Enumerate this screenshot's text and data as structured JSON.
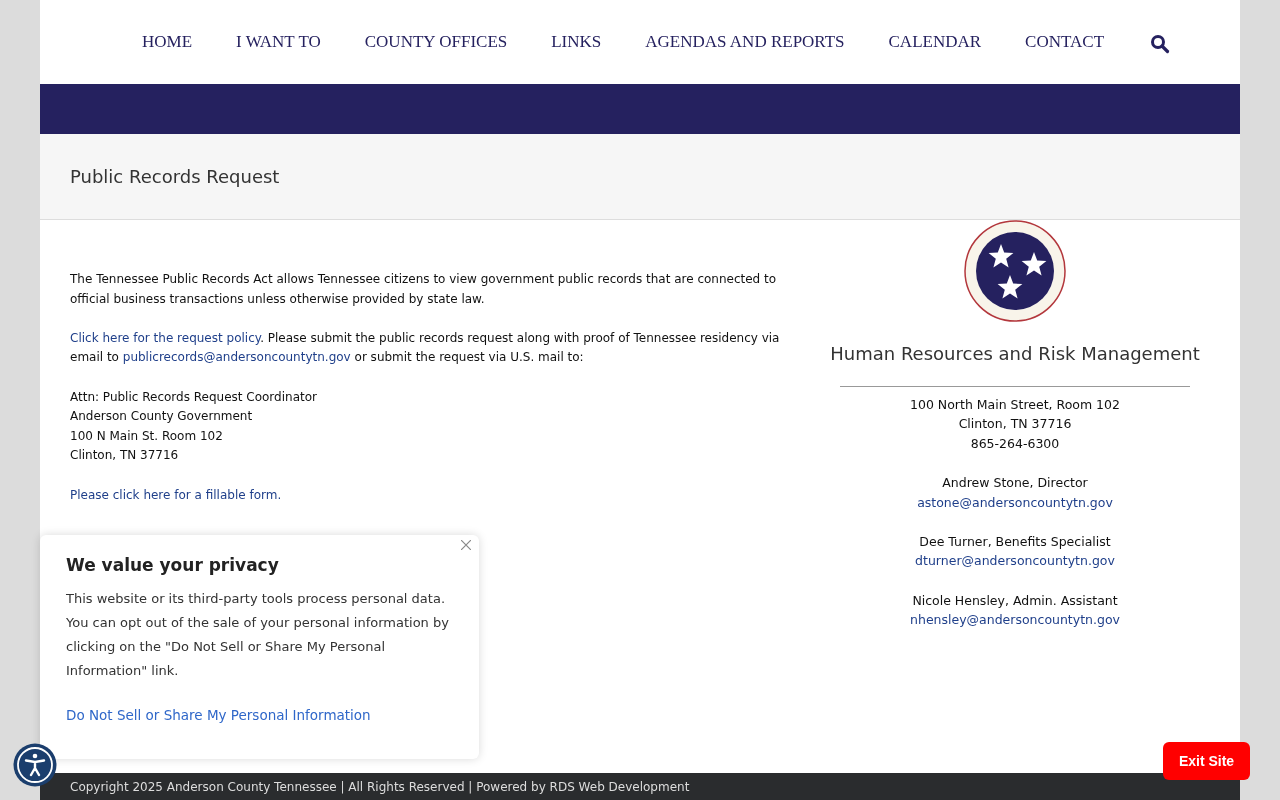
{
  "nav": {
    "items": [
      {
        "label": "HOME"
      },
      {
        "label": "I WANT TO"
      },
      {
        "label": "COUNTY OFFICES"
      },
      {
        "label": "LINKS"
      },
      {
        "label": "AGENDAS AND REPORTS"
      },
      {
        "label": "CALENDAR"
      },
      {
        "label": "CONTACT"
      }
    ]
  },
  "page_title": "Public Records Request",
  "content": {
    "paragraphs": [
      {
        "kind": "text",
        "text": "The Tennessee Public Records Act allows Tennessee citizens to view government public records that are connected to official business transactions unless otherwise provided by state law."
      },
      {
        "kind": "mixed",
        "parts": [
          {
            "kind": "link",
            "text": "Click here for the request policy"
          },
          {
            "kind": "text",
            "text": ". Please submit the public records request along with proof of Tennessee residency via email to "
          },
          {
            "kind": "link",
            "text": "publicrecords@andersoncountytn.gov"
          },
          {
            "kind": "text",
            "text": " or submit the request via U.S. mail to:"
          }
        ]
      },
      {
        "kind": "lines",
        "lines": [
          "Attn: Public Records Request Coordinator",
          "Anderson County Government",
          "100 N Main St. Room 102",
          "Clinton, TN 37716"
        ]
      },
      {
        "kind": "link",
        "text": "Please click here for a fillable form."
      }
    ]
  },
  "sidebar": {
    "heading": "Human Resources and Risk Management",
    "address": [
      "100 North Main Street, Room 102",
      "Clinton, TN 37716",
      "865-264-6300"
    ],
    "contacts": [
      {
        "name": "Andrew Stone, Director",
        "email": "astone@andersoncountytn.gov"
      },
      {
        "name": "Dee Turner, Benefits Specialist",
        "email": "dturner@andersoncountytn.gov"
      },
      {
        "name": "Nicole Hensley, Admin. Assistant",
        "email": "nhensley@andersoncountytn.gov"
      }
    ]
  },
  "footer": {
    "text": "Copyright 2025 Anderson County Tennessee | All Rights Reserved | Powered by RDS Web Development"
  },
  "privacy_popup": {
    "title": "We value your privacy",
    "body": "This website or its third-party tools process personal data. You can opt out of the sale of your personal information by clicking on the \"Do Not Sell or Share My Personal Information\" link.",
    "link": "Do Not Sell or Share My Personal Information"
  },
  "exit_button": "Exit Site"
}
